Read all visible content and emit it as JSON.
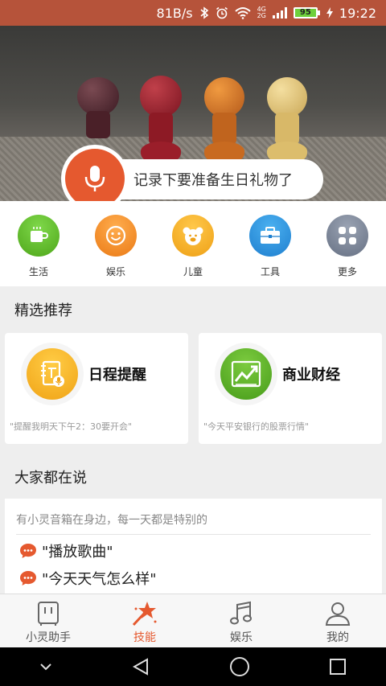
{
  "status_bar": {
    "speed": "81B/s",
    "network": "4G",
    "network2": "2G",
    "battery": "95",
    "time": "19:22"
  },
  "banner": {
    "voice_prompt": "记录下要准备生日礼物了"
  },
  "categories": [
    {
      "label": "生活",
      "icon": "coffee-icon",
      "color": "#53b41f"
    },
    {
      "label": "娱乐",
      "icon": "smile-icon",
      "color": "#f08a22"
    },
    {
      "label": "儿童",
      "icon": "bear-icon",
      "color": "#f2a91d"
    },
    {
      "label": "工具",
      "icon": "toolbox-icon",
      "color": "#2b8bd9"
    },
    {
      "label": "更多",
      "icon": "grid-icon",
      "color": "#6f7a8c"
    }
  ],
  "featured": {
    "title": "精选推荐",
    "cards": [
      {
        "name": "日程提醒",
        "hint": "\"提醒我明天下午2：30要开会\"",
        "icon": "schedule-reminder-icon",
        "color": "#f2b11e"
      },
      {
        "name": "商业财经",
        "hint": "\"今天平安银行的股票行情\"",
        "icon": "stock-chart-icon",
        "color": "#53a821"
      }
    ]
  },
  "talk": {
    "title": "大家都在说",
    "intro": "有小灵音箱在身边，每一天都是特别的",
    "examples": [
      "\"播放歌曲\"",
      "\"今天天气怎么样\""
    ]
  },
  "bottom_nav": [
    {
      "label": "小灵助手",
      "icon": "speaker-icon",
      "active": false
    },
    {
      "label": "技能",
      "icon": "magic-wand-icon",
      "active": true
    },
    {
      "label": "娱乐",
      "icon": "music-note-icon",
      "active": false
    },
    {
      "label": "我的",
      "icon": "person-icon",
      "active": false
    }
  ],
  "colors": {
    "accent": "#e5592f",
    "status_bar": "#b6533a"
  }
}
